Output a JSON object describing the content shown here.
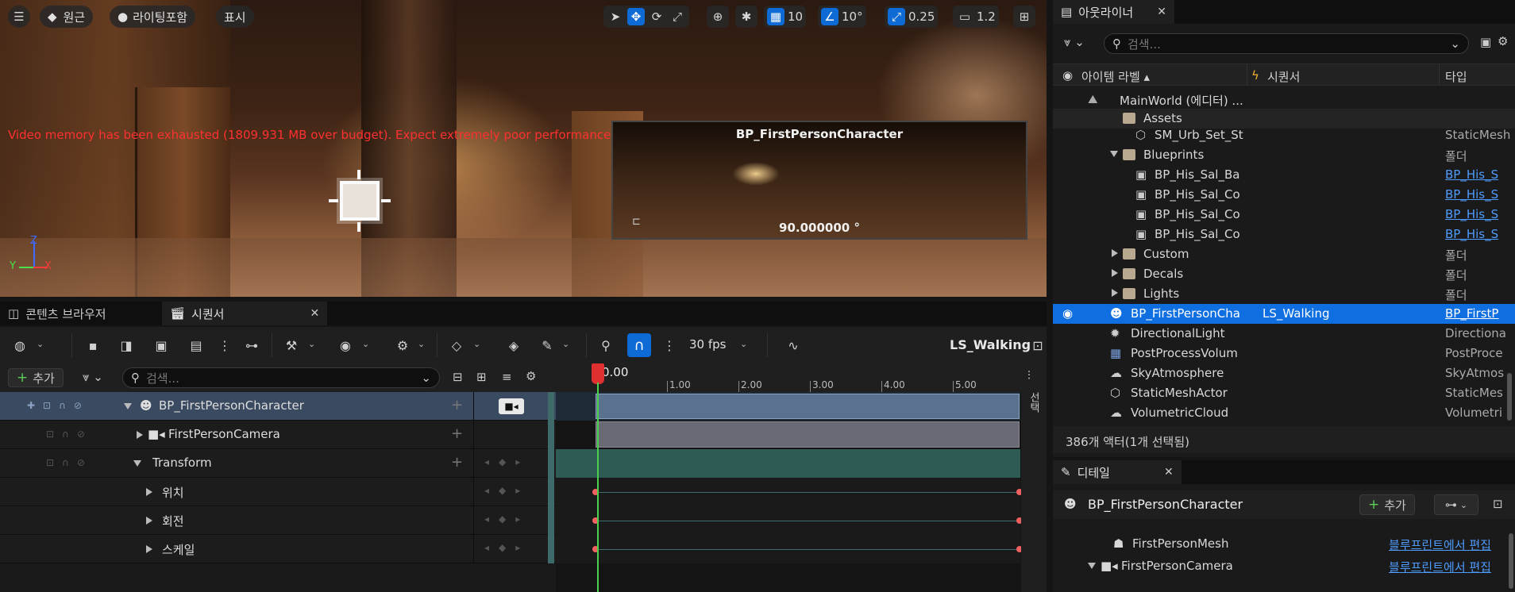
{
  "viewport": {
    "menu_icon": "hamburger-icon",
    "perspective_label": "원근",
    "lighting_label": "라이팅포함",
    "show_label": "표시",
    "grid_snap_value": "10",
    "rotation_snap_value": "10°",
    "scale_snap_value": "0.25",
    "camera_speed_value": "1.2",
    "warning_text": "Video memory has been exhausted (1809.931 MB over budget). Expect extremely poor performance.",
    "pip_title": "BP_FirstPersonCharacter",
    "pip_angle": "90.000000 °",
    "axis_z": "Z",
    "axis_x": "X",
    "axis_y": "Y"
  },
  "outliner": {
    "tab_title": "아웃라이너",
    "search_placeholder": "검색...",
    "columns": {
      "label": "아이템 라벨 ▴",
      "sequencer": "시퀀서",
      "type": "타입"
    },
    "rows": [
      {
        "name": "MainWorld (에디터) ...",
        "type": "",
        "seq": ""
      },
      {
        "name": "Assets",
        "type": "",
        "seq": ""
      },
      {
        "name": "SM_Urb_Set_St",
        "type": "StaticMesh",
        "seq": ""
      },
      {
        "name": "Blueprints",
        "type": "폴더",
        "seq": ""
      },
      {
        "name": "BP_His_Sal_Ba",
        "type": "BP_His_S",
        "seq": ""
      },
      {
        "name": "BP_His_Sal_Co",
        "type": "BP_His_S",
        "seq": ""
      },
      {
        "name": "BP_His_Sal_Co",
        "type": "BP_His_S",
        "seq": ""
      },
      {
        "name": "BP_His_Sal_Co",
        "type": "BP_His_S",
        "seq": ""
      },
      {
        "name": "Custom",
        "type": "폴더",
        "seq": ""
      },
      {
        "name": "Decals",
        "type": "폴더",
        "seq": ""
      },
      {
        "name": "Lights",
        "type": "폴더",
        "seq": ""
      },
      {
        "name": "BP_FirstPersonCha",
        "type": "BP_FirstP",
        "seq": "LS_Walking"
      },
      {
        "name": "DirectionalLight",
        "type": "Directiona",
        "seq": ""
      },
      {
        "name": "PostProcessVolum",
        "type": "PostProce",
        "seq": ""
      },
      {
        "name": "SkyAtmosphere",
        "type": "SkyAtmos",
        "seq": ""
      },
      {
        "name": "StaticMeshActor",
        "type": "StaticMes",
        "seq": ""
      },
      {
        "name": "VolumetricCloud",
        "type": "Volumetri",
        "seq": ""
      }
    ],
    "status": "386개 액터(1개 선택됨)"
  },
  "details": {
    "tab_title": "디테일",
    "object_name": "BP_FirstPersonCharacter",
    "add_label": "추가",
    "rows": [
      {
        "name": "FirstPersonMesh",
        "link": "블루프린트에서 편집"
      },
      {
        "name": "FirstPersonCamera",
        "link": "블루프린트에서 편집"
      }
    ]
  },
  "sequencer": {
    "tab_content_browser": "콘텐츠 브라우저",
    "tab_sequencer": "시퀀서",
    "fps_label": "30 fps",
    "sequence_name": "LS_Walking",
    "add_label": "추가",
    "search_placeholder": "검색...",
    "current_time": "0.00",
    "ticks": [
      "1.00",
      "2.00",
      "3.00",
      "4.00",
      "5.00"
    ],
    "side_label": "선택",
    "tracks": [
      {
        "label": "BP_FirstPersonCharacter"
      },
      {
        "label": "FirstPersonCamera"
      },
      {
        "label": "Transform"
      },
      {
        "label": "위치"
      },
      {
        "label": "회전"
      },
      {
        "label": "스케일"
      }
    ]
  },
  "colors": {
    "accent": "#0e6bd6",
    "selection": "#0f6fe0",
    "warning": "#ff3030",
    "link": "#4f9cff",
    "keyframe": "#f06060"
  }
}
